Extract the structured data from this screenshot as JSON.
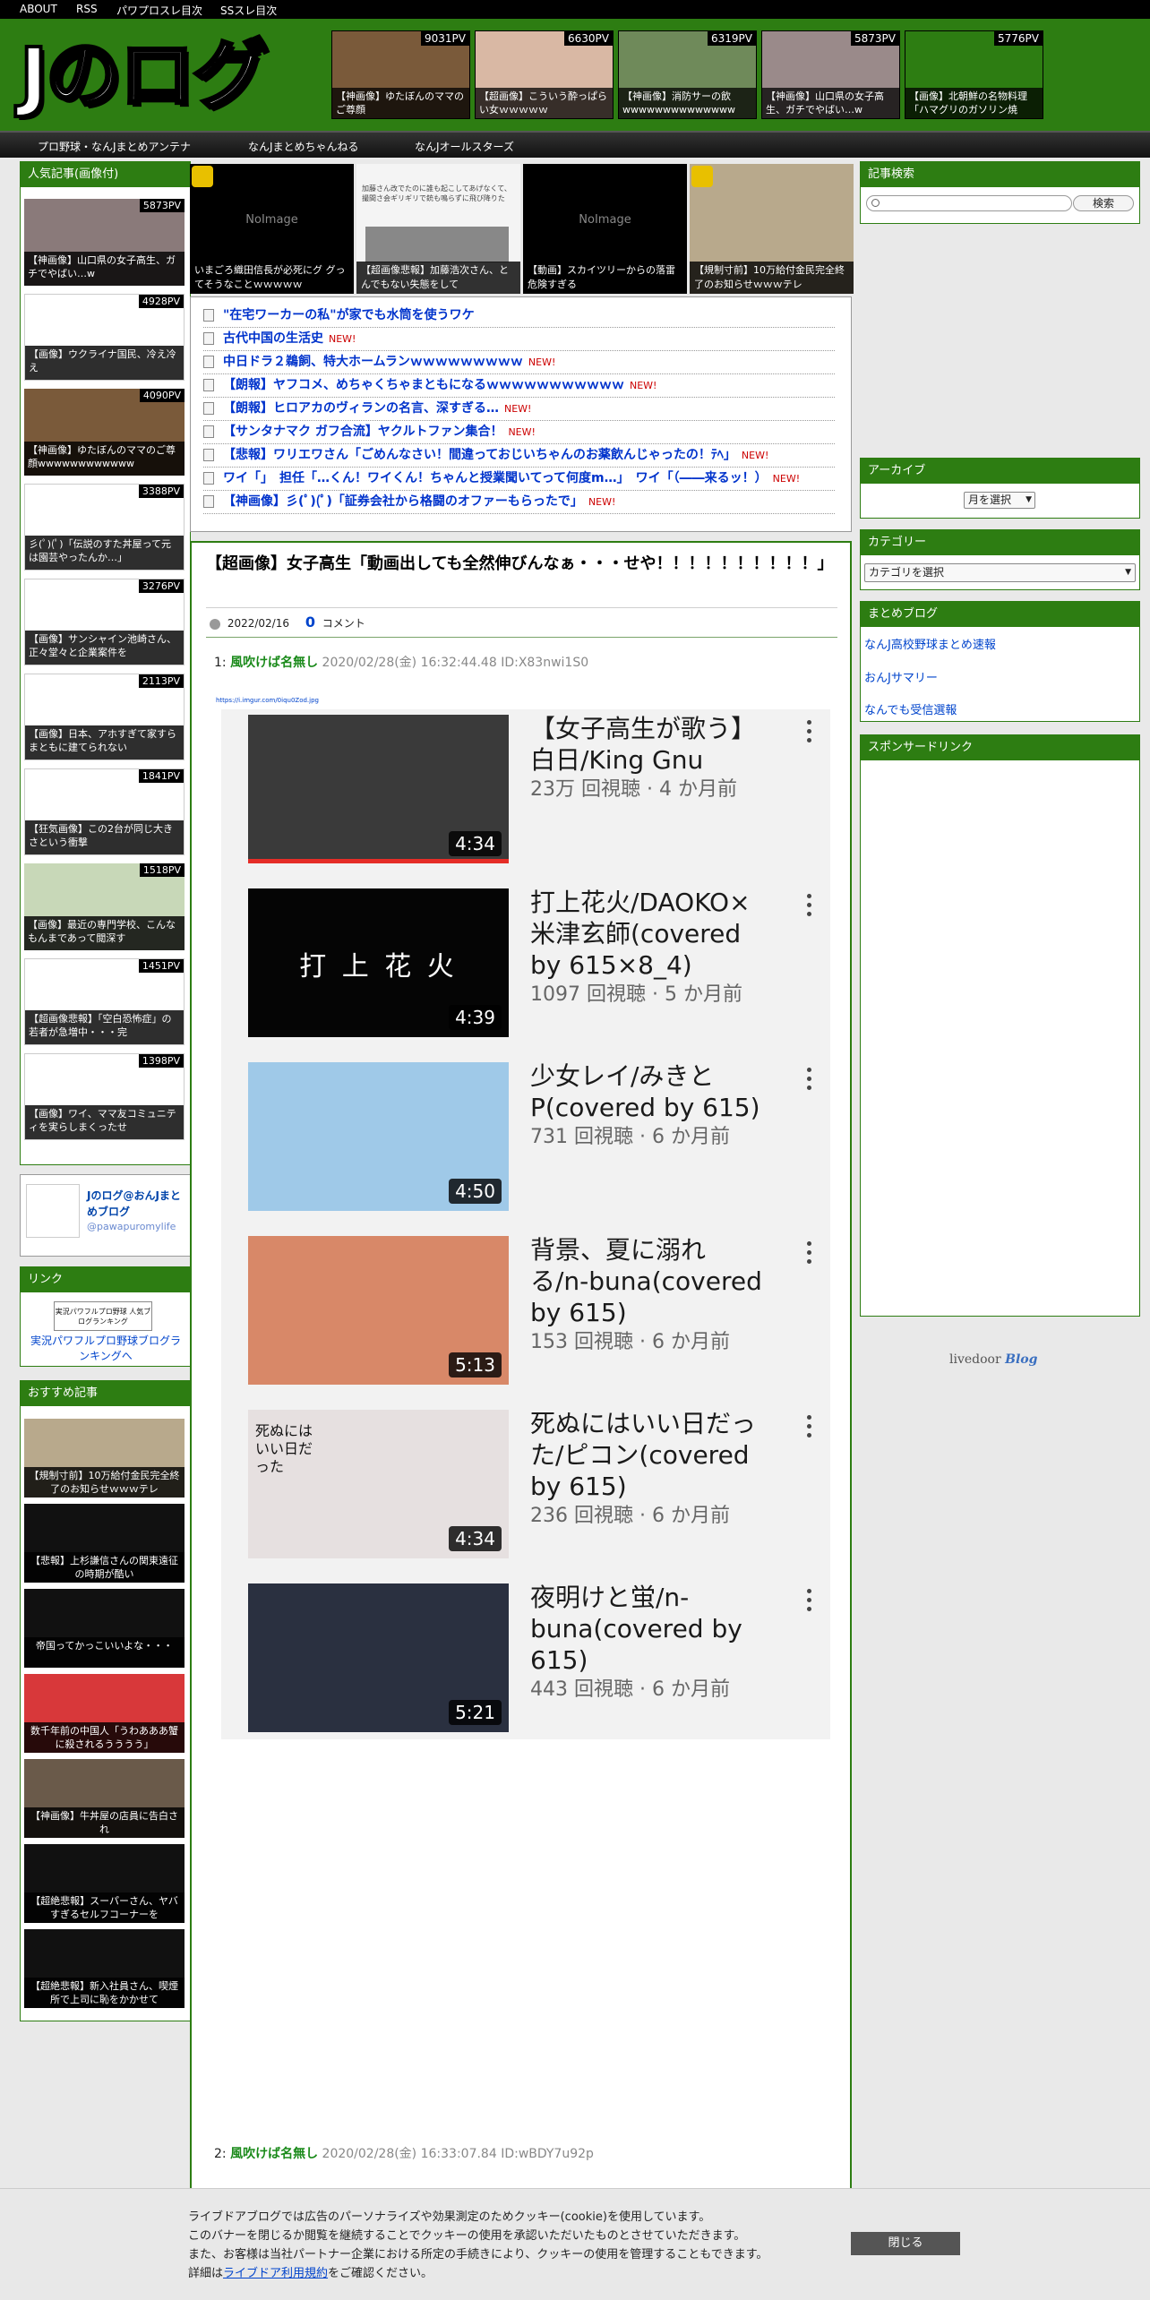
{
  "topbar": [
    "ABOUT",
    "RSS",
    "パワプロスレ目次",
    "SSスレ目次"
  ],
  "logo_text": "Jのログ",
  "header_thumbs": [
    {
      "pv": "9031PV",
      "caption": "【神画像】ゆたぼんのママのご尊顔"
    },
    {
      "pv": "6630PV",
      "caption": "【超画像】こういう酔っぱらい女ｗｗｗｗｗ"
    },
    {
      "pv": "6319PV",
      "caption": "【神画像】消防サーの飲wwwwwwwwwwwwww"
    },
    {
      "pv": "5873PV",
      "caption": "【神画像】山口県の女子高生、ガチでやばい…w"
    },
    {
      "pv": "5776PV",
      "caption": "【画像】北朝鮮の名物料理「ハマグリのガソリン焼"
    }
  ],
  "nav": [
    "プロ野球・なんJまとめアンテナ",
    "なんJまとめちゃんねる",
    "なんJオールスターズ"
  ],
  "left": {
    "popular_title": "人気記事(画像付)",
    "popular": [
      {
        "pv": "5873PV",
        "caption": "【神画像】山口県の女子高生、ガチでやばい…w"
      },
      {
        "pv": "4928PV",
        "caption": "【画像】ウクライナ国民、冷え冷え"
      },
      {
        "pv": "4090PV",
        "caption": "【神画像】ゆたぼんのママのご尊顔wwwwwwwwwwww"
      },
      {
        "pv": "3388PV",
        "caption": "彡(ﾟ)(ﾟ)「伝説のすた丼屋って元は園芸やったんか…」"
      },
      {
        "pv": "3276PV",
        "caption": "【画像】サンシャイン池崎さん、正々堂々と企業案件を"
      },
      {
        "pv": "2113PV",
        "caption": "【画像】日本、アホすぎて家すらまともに建てられない"
      },
      {
        "pv": "1841PV",
        "caption": "【狂気画像】この2台が同じ大きさという衝撃"
      },
      {
        "pv": "1518PV",
        "caption": "【画像】最近の専門学校、こんなもんまであって閲深す"
      },
      {
        "pv": "1451PV",
        "caption": "【超画像悲報】「空白恐怖症」の若者が急増中・・・完"
      },
      {
        "pv": "1398PV",
        "caption": "【画像】ワイ、ママ友コミュニティを実らしまくったせ"
      }
    ],
    "twitter_name": "Jのログ@おんJまとめブログ",
    "twitter_handle": "@pawapuromylife",
    "link_title": "リンク",
    "link_banner": "実況パワフルプロ野球 人気ブログランキング",
    "link_text": "実況パワフルプロ野球ブログランキングへ",
    "recommend_title": "おすすめ記事",
    "recommend": [
      "【規制寸前】10万給付金民完全終了のお知らせｗｗｗテレ",
      "【悲報】上杉謙信さんの関東遠征の時期が酷い",
      "帝国ってかっこいいよな・・・",
      "数千年前の中国人「うわあああ蟹に殺されるうううう」",
      "【神画像】牛丼屋の店員に告白され",
      "【超絶悲報】スーパーさん、ヤバすぎるセルフコーナーを",
      "【超絶悲報】新入社員さん、喫煙所で上司に恥をかかせて"
    ]
  },
  "center_thumbs": [
    {
      "caption": "いまごろ織田信長が必死にグ グってそうなことｗｗｗｗｗ",
      "noimage": "NoImage"
    },
    {
      "caption": "【超画像悲報】加藤浩次さん、とんでもない失態をして",
      "noimage": ""
    },
    {
      "caption": "【動画】スカイツリーからの落雷　危険すぎる",
      "noimage": "NoImage"
    },
    {
      "caption": "【規制寸前】10万給付金民完全終了のお知らせｗｗｗテレ",
      "noimage": ""
    }
  ],
  "center_thumb2_text": "加藤さん改でたのに誰も起こしてあげなくて、撮間さ会ギリギリで銃も鳴らずに飛び降りた",
  "news": [
    {
      "title": "\"在宅ワーカーの私\"が家でも水筒を使うワケ",
      "new": ""
    },
    {
      "title": "古代中国の生活史",
      "new": "NEW!"
    },
    {
      "title": "中日ドラ２鵜飼、特大ホームランｗｗｗｗｗｗｗｗｗ",
      "new": "NEW!"
    },
    {
      "title": "【朗報】ヤフコメ、めちゃくちゃまともになるｗｗｗｗｗｗｗｗｗｗｗ",
      "new": "NEW!"
    },
    {
      "title": "【朗報】ヒロアカのヴィランの名言、深すぎる…",
      "new": "NEW!"
    },
    {
      "title": "【サンタナマク ガフ合流】ヤクルトファン集合！",
      "new": "NEW!"
    },
    {
      "title": "【悲報】ワリエワさん「ごめんなさい！間違っておじいちゃんのお薬飲んじゃったの！ﾃﾍ」",
      "new": "NEW!"
    },
    {
      "title": "ワイ「」　担任「…くん！ワイくん！ちゃんと授業聞いてって何度m…」　ワイ「（――来るッ！）",
      "new": "NEW!"
    },
    {
      "title": "【神画像】彡(ﾟ)(ﾟ)「証券会社から格闘のオファーもらったで」",
      "new": "NEW!"
    }
  ],
  "article": {
    "title": "【超画像】女子高生「動画出しても全然伸びんなぁ・・・せや！！！！！！！！！！」",
    "date": "2022/02/16",
    "comment_count": "0",
    "comment_label": "コメント",
    "res1": {
      "num": "1:",
      "name": "風吹けば名無し",
      "datetime": "2020/02/28(金) 16:32:44.48 ID:X83nwi1S0"
    },
    "img_url": "https://i.imgur.com/0iqu0Zod.jpg",
    "videos": [
      {
        "title": "【女子高生が歌う】白日/King Gnu",
        "meta": "23万 回視聴 · 4 か月前",
        "duration": "4:34",
        "overlay": ""
      },
      {
        "title": "打上花火/DAOKO×米津玄師(covered by 615×8_4)",
        "meta": "1097 回視聴 · 5 か月前",
        "duration": "4:39",
        "overlay": "打 上 花 火"
      },
      {
        "title": "少女レイ/みきとP(covered by 615)",
        "meta": "731 回視聴 · 6 か月前",
        "duration": "4:50",
        "overlay": ""
      },
      {
        "title": "背景、夏に溺れる/n-buna(covered by 615)",
        "meta": "153 回視聴 · 6 か月前",
        "duration": "5:13",
        "overlay": ""
      },
      {
        "title": "死ぬにはいい日だった/ピコン(covered by 615)",
        "meta": "236 回視聴 · 6 か月前",
        "duration": "4:34",
        "overlay": "死ぬには いい日だった"
      },
      {
        "title": "夜明けと蛍/n-buna(covered by 615)",
        "meta": "443 回視聴 · 6 か月前",
        "duration": "5:21",
        "overlay": ""
      }
    ],
    "res2": {
      "num": "2:",
      "name": "風吹けば名無し",
      "datetime": "2020/02/28(金) 16:33:07.84 ID:wBDY7u92p"
    }
  },
  "right": {
    "search_title": "記事検索",
    "search_button": "検索",
    "archive_title": "アーカイブ",
    "archive_select": "月を選択",
    "category_title": "カテゴリー",
    "category_select": "カテゴリを選択",
    "matome_title": "まとめブログ",
    "matome": [
      "なんJ高校野球まとめ速報",
      "おんJサマリー",
      "なんでも受信選報"
    ],
    "sponsor_title": "スポンサードリンク",
    "livedoor": "livedoor",
    "blog": "Blog"
  },
  "cookie": {
    "line1": "ライブドアブログでは広告のパーソナライズや効果測定のためクッキー(cookie)を使用しています。",
    "line2": "このバナーを閉じるか閲覧を継続することでクッキーの使用を承認いただいたものとさせていただきます。",
    "line3": "また、お客様は当社パートナー企業における所定の手続きにより、クッキーの使用を管理することもできます。",
    "line4_pre": "詳細は",
    "line4_link": "ライブドア利用規約",
    "line4_post": "をご確認ください。",
    "close": "閉じる"
  }
}
